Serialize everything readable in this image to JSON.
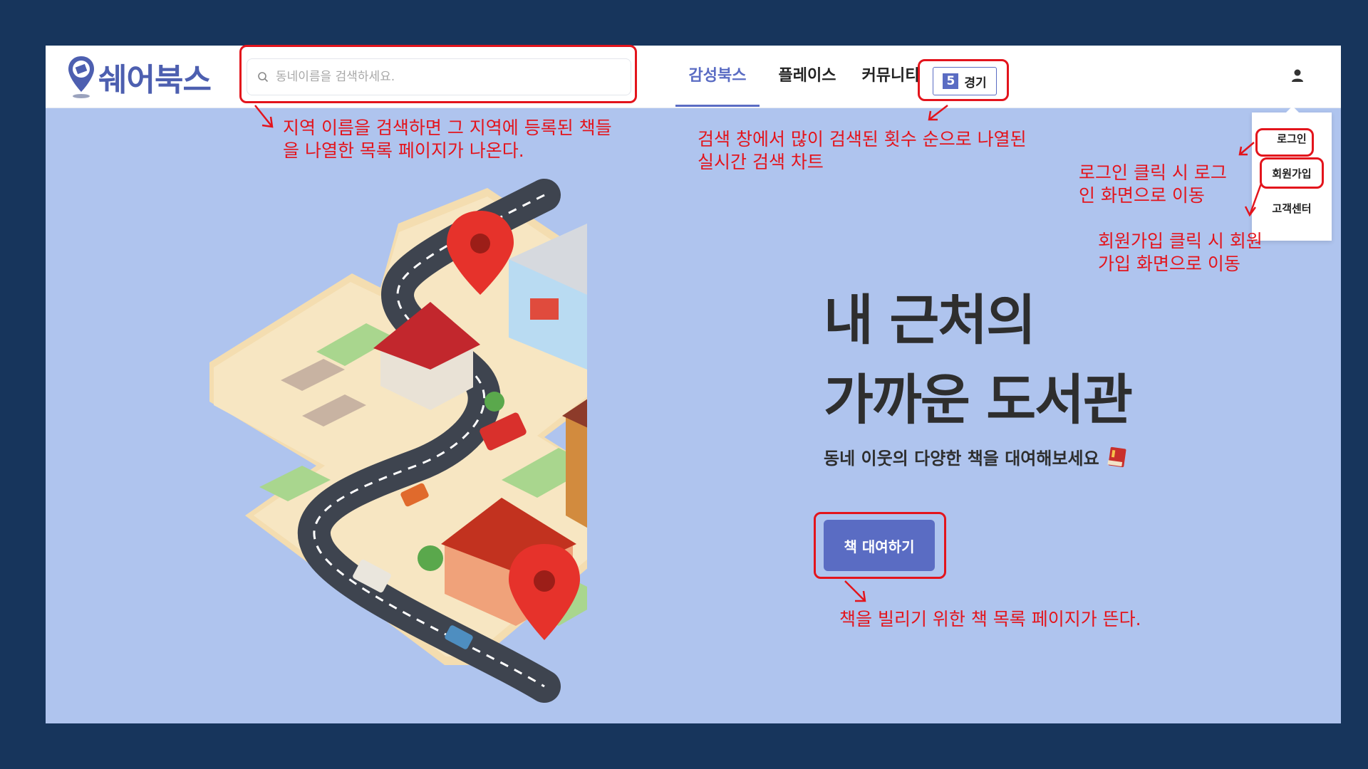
{
  "app": {
    "logo_text": "쉐어북스"
  },
  "search": {
    "placeholder": "동네이름을 검색하세요."
  },
  "nav": {
    "items": [
      {
        "label": "감성북스",
        "active": true
      },
      {
        "label": "플레이스",
        "active": false
      },
      {
        "label": "커뮤니티",
        "active": false
      }
    ],
    "realtime_rank": {
      "number": "5",
      "word": "경기"
    }
  },
  "user_menu": {
    "icon": "user-icon",
    "items": [
      "로그인",
      "회원가입",
      "고객센터"
    ]
  },
  "hero": {
    "title_line1": "내 근처의",
    "title_line2": "가까운 도서관",
    "subtitle": "동네 이웃의 다양한 책을 대여해보세요",
    "cta_label": "책 대여하기"
  },
  "annotations": {
    "search_note_line1": "지역 이름을 검색하면 그 지역에 등록된 책들",
    "search_note_line2": "을 나열한 목록 페이지가 나온다.",
    "rank_note_line1": "검색 창에서 많이 검색된 횟수 순으로 나열된",
    "rank_note_line2": "실시간 검색 차트",
    "login_note_line1": "로그인 클릭 시 로그",
    "login_note_line2": "인 화면으로 이동",
    "signup_note_line1": "회원가입 클릭 시 회원",
    "signup_note_line2": "가입 화면으로 이동",
    "cta_note": "책을 빌리기 위한 책 목록 페이지가 뜬다."
  },
  "colors": {
    "page_bg": "#17355c",
    "hero_bg": "#afc4ee",
    "accent": "#5a6cc3",
    "annotation_red": "#e3141c"
  }
}
